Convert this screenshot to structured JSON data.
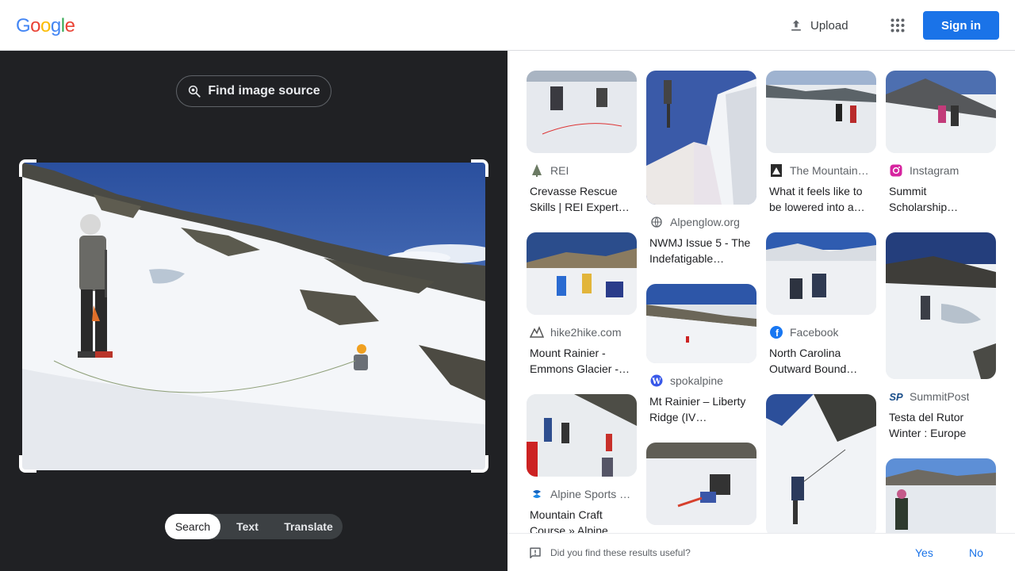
{
  "header": {
    "logo_letters": [
      "G",
      "o",
      "o",
      "g",
      "l",
      "e"
    ],
    "logo_colors": [
      "#4285F4",
      "#EA4335",
      "#FBBC05",
      "#4285F4",
      "#34A853",
      "#EA4335"
    ],
    "upload_label": "Upload",
    "signin_label": "Sign in"
  },
  "lens": {
    "find_source_label": "Find image source",
    "tabs": [
      {
        "label": "Search",
        "active": true
      },
      {
        "label": "Text",
        "active": false
      },
      {
        "label": "Translate",
        "active": false
      }
    ]
  },
  "results": {
    "col1": [
      {
        "source": "REI",
        "favicon": "tree-icon",
        "title": "Crevasse Rescue Skills | REI Expert…"
      },
      {
        "source": "hike2hike.com",
        "favicon": "hike2hike-icon",
        "title": "Mount Rainier - Emmons Glacier -…"
      },
      {
        "source": "Alpine Sports …",
        "favicon": "alpine-sports-icon",
        "title": "Mountain Craft Course » Alpine…"
      }
    ],
    "col2": [
      {
        "source": "Alpenglow.org",
        "favicon": "globe-icon",
        "title": "NWMJ Issue 5 - The Indefatigable…"
      },
      {
        "source": "spokalpine",
        "favicon": "wordpress-icon",
        "title": "Mt Rainier – Liberty Ridge (IV…"
      },
      {
        "source": "",
        "favicon": "",
        "title": ""
      }
    ],
    "col3": [
      {
        "source": "The Mountain…",
        "favicon": "mountain-icon",
        "title": "What it feels like to be lowered into a…"
      },
      {
        "source": "Facebook",
        "favicon": "facebook-icon",
        "title": "North Carolina Outward Bound…"
      },
      {
        "source": "",
        "favicon": "",
        "title": ""
      }
    ],
    "col4": [
      {
        "source": "Instagram",
        "favicon": "instagram-icon",
        "title": "Summit Scholarship…"
      },
      {
        "source": "SummitPost",
        "favicon": "summitpost-icon",
        "title": "Testa del Rutor Winter : Europe"
      },
      {
        "source": "",
        "favicon": "",
        "title": ""
      }
    ]
  },
  "feedback": {
    "question": "Did you find these results useful?",
    "yes": "Yes",
    "no": "No"
  }
}
